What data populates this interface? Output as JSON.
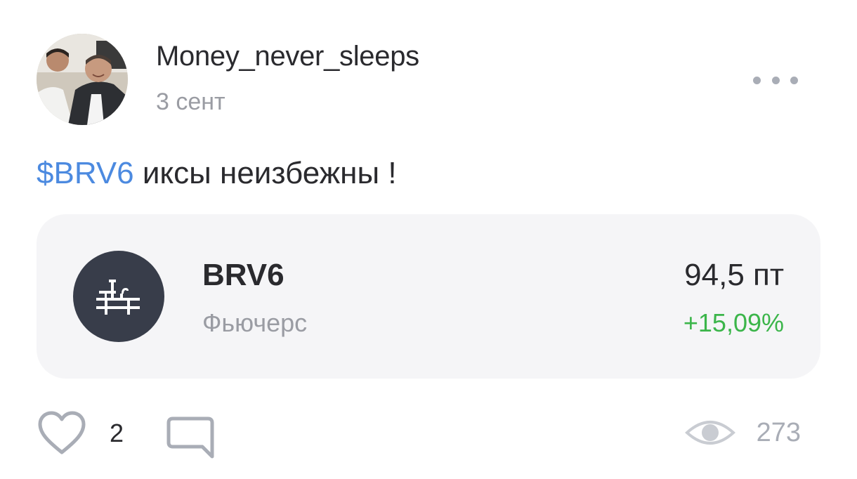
{
  "post": {
    "author": "Money_never_sleeps",
    "date": "3 сент",
    "ticker_link": "$BRV6",
    "text": " иксы неизбежны !"
  },
  "instrument": {
    "ticker": "BRV6",
    "type": "Фьючерс",
    "price": "94,5 пт",
    "change": "+15,09%",
    "icon": "oil-platform-icon"
  },
  "footer": {
    "likes": "2",
    "views": "273"
  },
  "colors": {
    "link": "#4c8ae0",
    "positive": "#3bb54a",
    "muted": "#9a9ca3",
    "card_bg": "#f5f5f7",
    "icon_bg": "#383d4a"
  }
}
